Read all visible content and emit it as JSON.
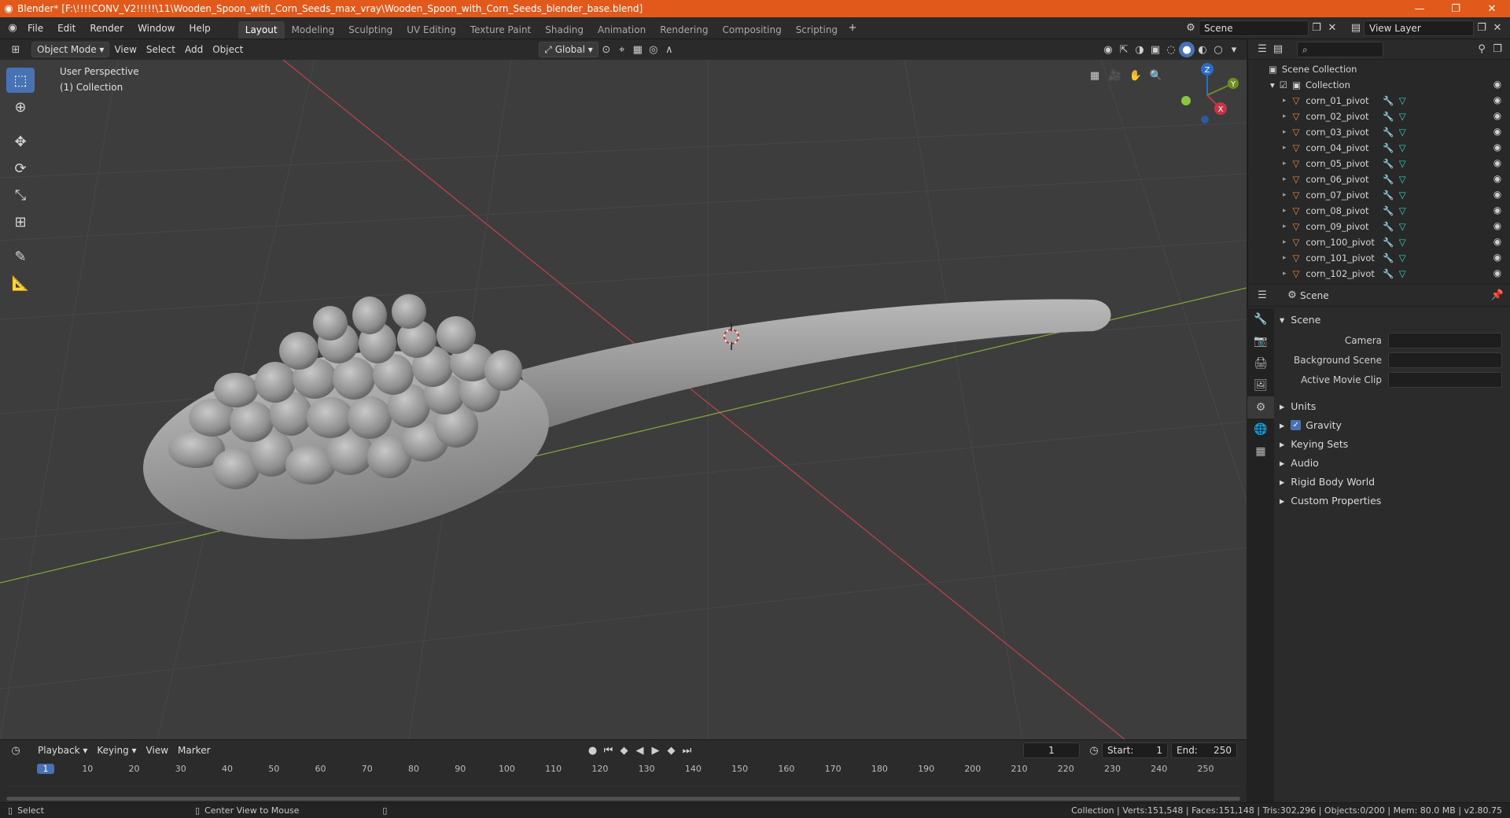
{
  "window": {
    "title": "Blender* [F:\\!!!!CONV_V2!!!!!\\11\\Wooden_Spoon_with_Corn_Seeds_max_vray\\Wooden_Spoon_with_Corn_Seeds_blender_base.blend]",
    "controls": [
      "—",
      "❐",
      "✕"
    ]
  },
  "menu": [
    "File",
    "Edit",
    "Render",
    "Window",
    "Help"
  ],
  "workspaces": [
    "Layout",
    "Modeling",
    "Sculpting",
    "UV Editing",
    "Texture Paint",
    "Shading",
    "Animation",
    "Rendering",
    "Compositing",
    "Scripting"
  ],
  "active_workspace": "Layout",
  "scene_selector": "Scene",
  "view_layer_selector": "View Layer",
  "viewport_header": {
    "mode": "Object Mode",
    "menus": [
      "View",
      "Select",
      "Add",
      "Object"
    ],
    "orientation": "Global"
  },
  "viewport": {
    "perspective_label": "User Perspective",
    "collection_label": "(1) Collection",
    "gizmo_axes": {
      "z": "Z",
      "y": "Y",
      "x": "X"
    }
  },
  "outliner": {
    "root": "Scene Collection",
    "collection": "Collection",
    "items": [
      "corn_01_pivot",
      "corn_02_pivot",
      "corn_03_pivot",
      "corn_04_pivot",
      "corn_05_pivot",
      "corn_06_pivot",
      "corn_07_pivot",
      "corn_08_pivot",
      "corn_09_pivot",
      "corn_100_pivot",
      "corn_101_pivot",
      "corn_102_pivot"
    ]
  },
  "properties": {
    "header": "Scene",
    "section": "Scene",
    "fields": [
      {
        "label": "Camera"
      },
      {
        "label": "Background Scene"
      },
      {
        "label": "Active Movie Clip"
      }
    ],
    "panels": [
      "Units",
      "Gravity",
      "Keying Sets",
      "Audio",
      "Rigid Body World",
      "Custom Properties"
    ],
    "gravity_checked": true
  },
  "timeline": {
    "menus": [
      "Playback",
      "Keying",
      "View",
      "Marker"
    ],
    "current_frame": "1",
    "start_label": "Start:",
    "start": "1",
    "end_label": "End:",
    "end": "250",
    "ruler": [
      "1",
      "10",
      "20",
      "30",
      "40",
      "50",
      "60",
      "70",
      "80",
      "90",
      "100",
      "110",
      "120",
      "130",
      "140",
      "150",
      "160",
      "170",
      "180",
      "190",
      "200",
      "210",
      "220",
      "230",
      "240",
      "250"
    ]
  },
  "statusbar": {
    "left": "Select",
    "middle": "Center View to Mouse",
    "stats": "Collection | Verts:151,548 | Faces:151,148 | Tris:302,296 | Objects:0/200 | Mem: 80.0 MB | v2.80.75"
  }
}
